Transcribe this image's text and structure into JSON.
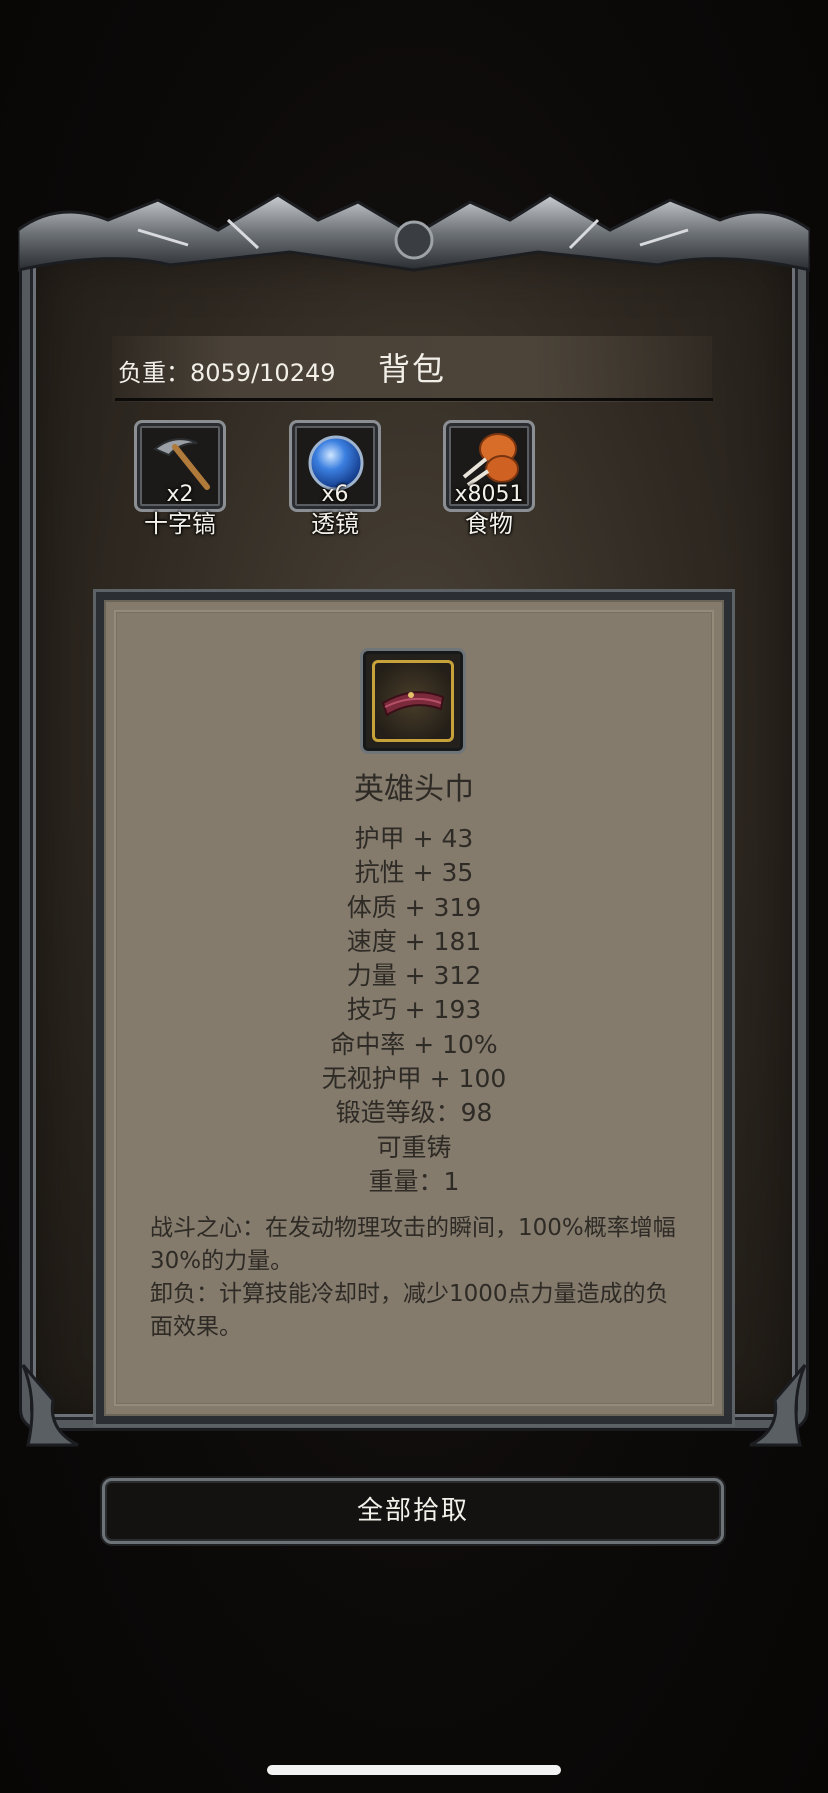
{
  "header": {
    "weight_text": "负重：8059/10249",
    "title": "背包"
  },
  "inventory": [
    {
      "name": "十字镐",
      "qty": "x2",
      "icon": "pickaxe-icon"
    },
    {
      "name": "透镜",
      "qty": "x6",
      "icon": "lens-orb-icon"
    },
    {
      "name": "食物",
      "qty": "x8051",
      "icon": "food-drumstick-icon"
    }
  ],
  "item": {
    "icon": "headband-icon",
    "name": "英雄头巾",
    "stats": [
      "护甲 + 43",
      "抗性 + 35",
      "体质 + 319",
      "速度 + 181",
      "力量 + 312",
      "技巧 + 193",
      "命中率 + 10%",
      "无视护甲 + 100",
      "锻造等级：98",
      "可重铸",
      "重量：1"
    ],
    "description": [
      "战斗之心：在发动物理攻击的瞬间，100%概率增幅30%的力量。",
      "卸负：计算技能冷却时，减少1000点力量造成的负面效果。"
    ]
  },
  "actions": {
    "pickup_all_label": "全部拾取"
  },
  "colors": {
    "panel": "#847b6c",
    "text_dark": "#2e2a25",
    "rarity_border": "#c7a23a",
    "frame_metal": "#6e7378"
  }
}
